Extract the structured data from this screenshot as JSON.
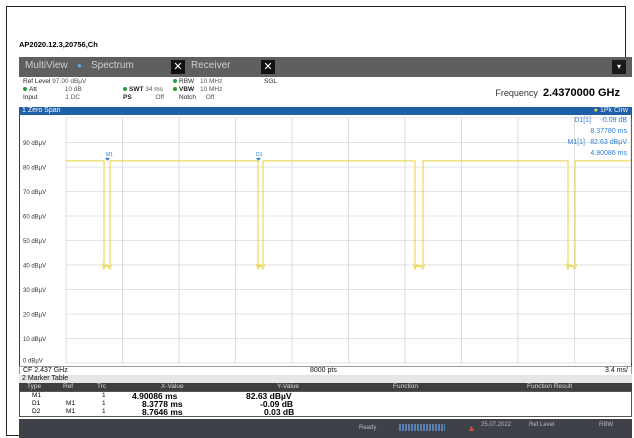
{
  "document": {
    "title": "AP2020.12.3,20756,Ch"
  },
  "tabs": [
    {
      "label": "MultiView"
    },
    {
      "label": "Spectrum"
    },
    {
      "label": "Receiver"
    }
  ],
  "settings": {
    "ref_level_label": "Ref Level",
    "ref_level_value": "97.00 dBµV",
    "att_label": "Att",
    "att_value": "10 dB",
    "swt_label": "SWT",
    "swt_value": "34 ms",
    "input_label": "Input",
    "input_value": "1 DC",
    "ps_label": "PS",
    "ps_value": "Off",
    "rbw_label": "RBW",
    "rbw_value": "10 MHz",
    "vbw_label": "VBW",
    "vbw_value": "10 MHz",
    "notch_label": "Notch",
    "notch_value": "Off",
    "mode": "SGL",
    "frequency_label": "Frequency",
    "frequency_value": "2.4370000 GHz"
  },
  "plot": {
    "title": "1 Zero Span",
    "trace_label": "1Pk Clrw",
    "y_ticks": [
      "90 dBµV",
      "80 dBµV",
      "70 dBµV",
      "60 dBµV",
      "50 dBµV",
      "40 dBµV",
      "30 dBµV",
      "20 dBµV",
      "10 dBµV",
      "0 dBµV"
    ],
    "marker_m1_label": "M1",
    "marker_d1_label": "D1[1]",
    "marker_d1_value": "-0.09 dB",
    "marker_d1_time": "8.37780 ms",
    "marker_m1_info_label": "M1[1]",
    "marker_m1_value": "82.63 dBµV",
    "marker_m1_time": "4.90086 ms",
    "plot_marker_d1": "D1",
    "trace_color": "#e8d23a",
    "marker_color": "#2f7fd4",
    "footer_left": "CF 2.437 GHz",
    "footer_mid": "8000 pts",
    "footer_right": "3.4 ms/"
  },
  "marker_table": {
    "title": "2 Marker Table",
    "columns": [
      "Type",
      "Ref",
      "Trc",
      "X-Value",
      "Y-Value",
      "Function",
      "Function Result"
    ],
    "rows": [
      {
        "type": "M1",
        "ref": "",
        "trc": "1",
        "x": "4.90086 ms",
        "y": "82.63 dBµV"
      },
      {
        "type": "D1",
        "ref": "M1",
        "trc": "1",
        "x": "8.3778 ms",
        "y": "-0.09 dB"
      },
      {
        "type": "D2",
        "ref": "M1",
        "trc": "1",
        "x": "8.7646 ms",
        "y": "0.03 dB"
      }
    ]
  },
  "status": {
    "ready": "Ready",
    "date": "25.07.2022",
    "ref_level": "Ref Level",
    "rbw": "RBW"
  }
}
